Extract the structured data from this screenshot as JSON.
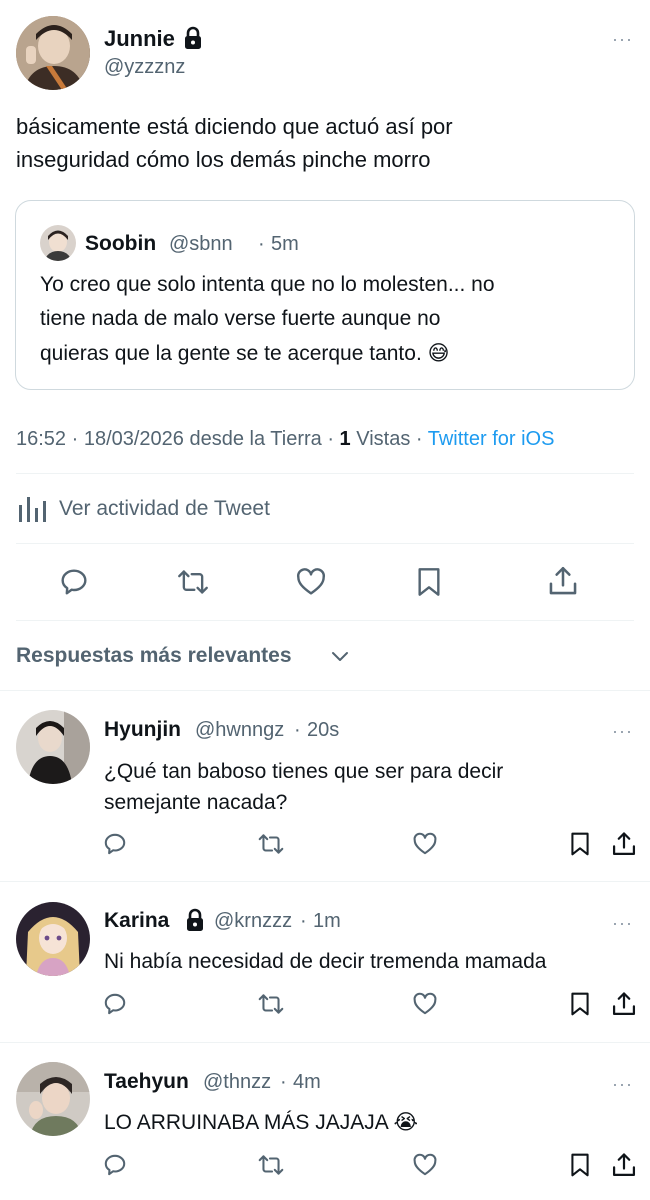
{
  "main_tweet": {
    "name": "Junnie",
    "handle": "@yzzznz",
    "text_line1": "básicamente está diciendo que actuó así por",
    "text_line2": "inseguridad cómo los demás pinche morro",
    "quote": {
      "name": "Soobin",
      "handle": "@sbnn",
      "sep": "·",
      "time": "5m",
      "line1": "Yo creo que solo intenta que no lo molesten... no",
      "line2": "tiene nada de malo verse fuerte aunque no",
      "line3": "quieras que la gente se te acerque tanto.",
      "emoji": "😅"
    },
    "meta": {
      "time_date": "16:52 · 18/03/2026 desde la Tierra · ",
      "views_count": "1",
      "views_label": " Vistas · ",
      "client": "Twitter for iOS"
    },
    "activity_label": "Ver actividad de Tweet"
  },
  "replies_header": "Respuestas más relevantes",
  "replies": [
    {
      "name": "Hyunjin",
      "handle": "@hwnngz",
      "sep": "·",
      "time": "20s",
      "line1": "¿Qué tan baboso tienes que ser para decir",
      "line2": "semejante nacada?",
      "locked": false
    },
    {
      "name": "Karina",
      "handle": "@krnzzz",
      "sep": "·",
      "time": "1m",
      "line1": "Ni había necesidad de decir tremenda mamada",
      "locked": true
    },
    {
      "name": "Taehyun",
      "handle": "@thnzz",
      "sep": "·",
      "time": "4m",
      "line1": "LO ARRUINABA MÁS JAJAJA",
      "emoji": "😭",
      "locked": false
    }
  ],
  "more_glyph": "···",
  "colors": {
    "link": "#1d9bf0",
    "text": "#0f1419",
    "secondary": "#536471",
    "border": "#cfd9de"
  }
}
